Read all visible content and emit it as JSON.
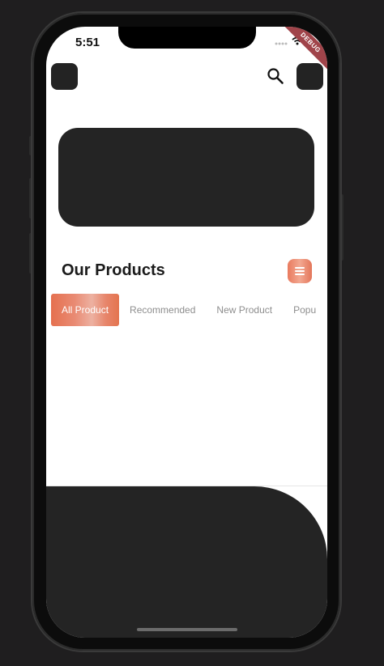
{
  "status": {
    "time": "5:51",
    "debug_label": "DEBUG"
  },
  "header": {
    "left_button_icon": "placeholder-square",
    "search_icon": "search-icon",
    "right_button_icon": "placeholder-square"
  },
  "section": {
    "title": "Our Products",
    "menu_icon": "menu-icon"
  },
  "tabs": [
    {
      "label": "All Product",
      "active": true
    },
    {
      "label": "Recommended",
      "active": false
    },
    {
      "label": "New Product",
      "active": false
    },
    {
      "label": "Popu",
      "active": false
    }
  ],
  "colors": {
    "accent": "#e5704f",
    "dark_surface": "#242424",
    "tab_inactive_text": "#8e8e8e"
  }
}
